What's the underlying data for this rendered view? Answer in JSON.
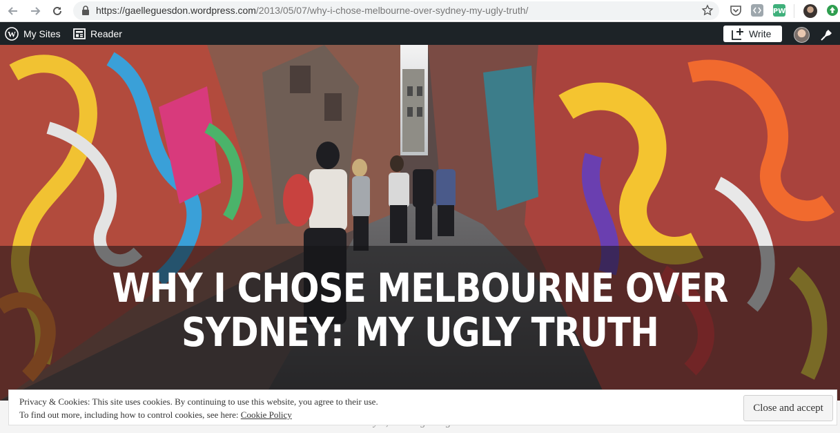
{
  "browser": {
    "url_host": "https://gaelleguesdon.wordpress.com",
    "url_path": "/2013/05/07/why-i-chose-melbourne-over-sydney-my-ugly-truth/"
  },
  "admin_bar": {
    "my_sites": "My Sites",
    "reader": "Reader",
    "write": "Write"
  },
  "post": {
    "title": "WHY I CHOSE MELBOURNE OVER SYDNEY: MY UGLY TRUTH",
    "meta": "May 7, 2013  •  gaelleguesdon"
  },
  "cookie_banner": {
    "line1": "Privacy & Cookies: This site uses cookies. By continuing to use this website, you agree to their use.",
    "line2_prefix": "To find out more, including how to control cookies, see here: ",
    "link": "Cookie Policy",
    "button": "Close and accept"
  },
  "colors": {
    "admin_bar": "#1d2327",
    "overlay": "rgba(20,20,22,0.55)"
  }
}
